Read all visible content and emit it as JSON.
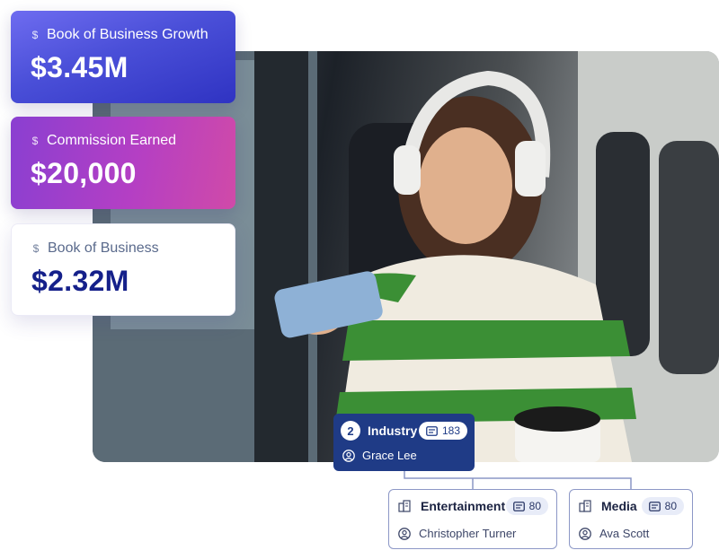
{
  "metrics": [
    {
      "label": "Book of Business Growth",
      "value": "$3.45M",
      "icon": "dollar-icon"
    },
    {
      "label": "Commission Earned",
      "value": "$20,000",
      "icon": "dollar-icon"
    },
    {
      "label": "Book of Business",
      "value": "$2.32M",
      "icon": "dollar-icon"
    }
  ],
  "photo": {
    "icon": "photo-woman-on-train"
  },
  "tree": {
    "root": {
      "number": "2",
      "title": "Industry",
      "count": "183",
      "person": "Grace Lee"
    },
    "children": [
      {
        "title": "Entertainment",
        "count": "80",
        "person": "Christopher Turner"
      },
      {
        "title": "Media",
        "count": "80",
        "person": "Ava Scott"
      }
    ]
  },
  "colors": {
    "card_growth": "#4a4fd8",
    "card_commission": "#b43fc4",
    "card_book_value": "#15208a",
    "tree_root": "#1f3b86",
    "tree_border": "#8c97c6"
  }
}
